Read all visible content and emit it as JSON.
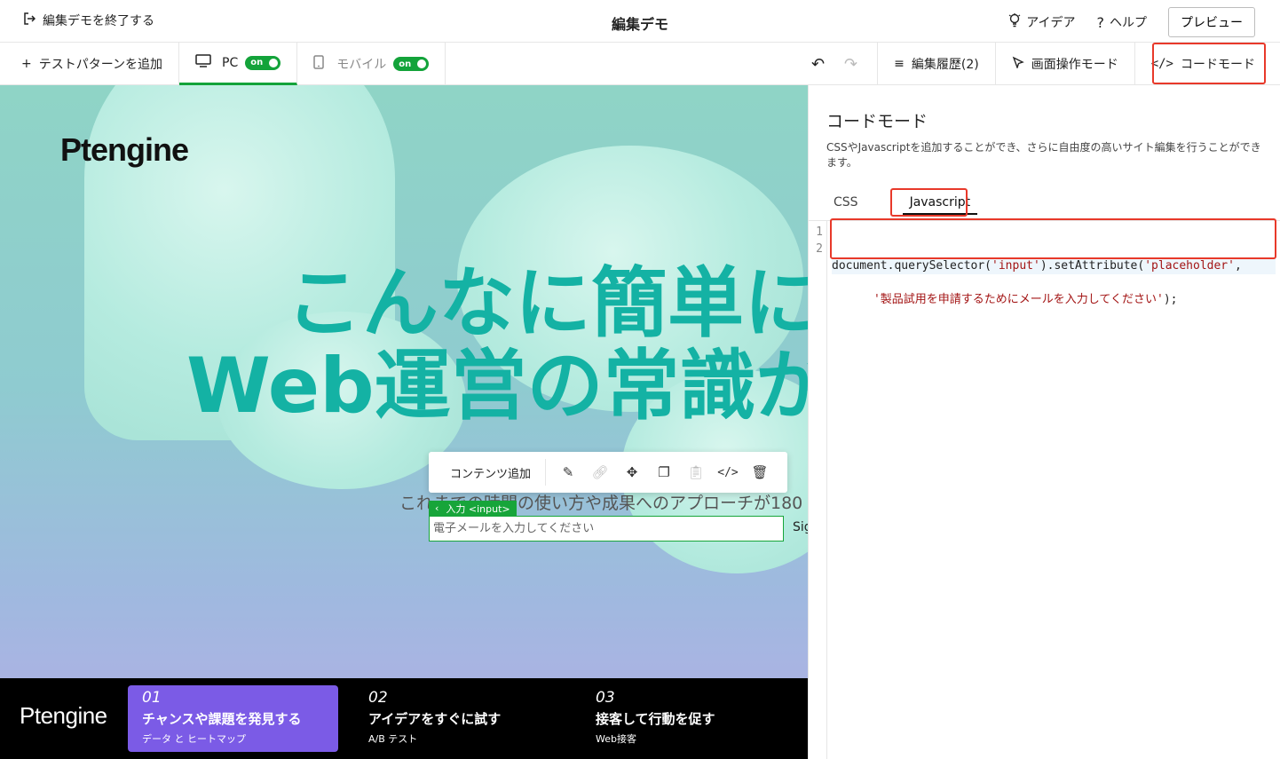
{
  "topbar": {
    "exit_label": "編集デモを終了する",
    "title": "編集デモ",
    "idea_label": "アイデア",
    "help_label": "ヘルプ",
    "preview_label": "プレビュー"
  },
  "toolbar": {
    "add_pattern_label": "テストパターンを追加",
    "pc_label": "PC",
    "pc_toggle": "on",
    "mobile_label": "モバイル",
    "mobile_toggle": "on",
    "history_label": "編集履歴(2)",
    "screen_mode_label": "画面操作モード",
    "code_mode_label": "コードモード"
  },
  "canvas": {
    "logo": "Ptengine",
    "headline_line1": "こんなに簡単に",
    "headline_line2": "Web運営の常識が",
    "subcopy": "これまでの時間の使い方や成果へのアプローチが180",
    "context_toolbar": {
      "add_content_label": "コンテンツ追加"
    },
    "input_tag": "入力 <input>",
    "email_placeholder": "電子メールを入力してください",
    "signup_label": "Sig",
    "bottom": {
      "logo": "Ptengine",
      "features": [
        {
          "num": "01",
          "title": "チャンスや課題を発見する",
          "sub": "データ と ヒートマップ"
        },
        {
          "num": "02",
          "title": "アイデアをすぐに試す",
          "sub": "A/B テスト"
        },
        {
          "num": "03",
          "title": "接客して行動を促す",
          "sub": "Web接客"
        }
      ]
    }
  },
  "panel": {
    "title": "コードモード",
    "description": "CSSやJavascriptを追加することができ、さらに自由度の高いサイト編集を行うことができます。",
    "tabs": {
      "css": "CSS",
      "js": "Javascript"
    },
    "line_numbers": [
      "1",
      "2"
    ],
    "code": {
      "l1_a": "document.querySelector(",
      "l1_b": "'input'",
      "l1_c": ").setAttribute(",
      "l1_d": "'placeholder'",
      "l1_e": ",",
      "l2_a": "'製品試用を申請するためにメールを入力してください'",
      "l2_b": ");"
    }
  },
  "colors": {
    "accent_green": "#13a33a",
    "highlight_red": "#e8392a",
    "headline_teal": "#14b2a4",
    "feature_purple": "#7b5be6"
  }
}
